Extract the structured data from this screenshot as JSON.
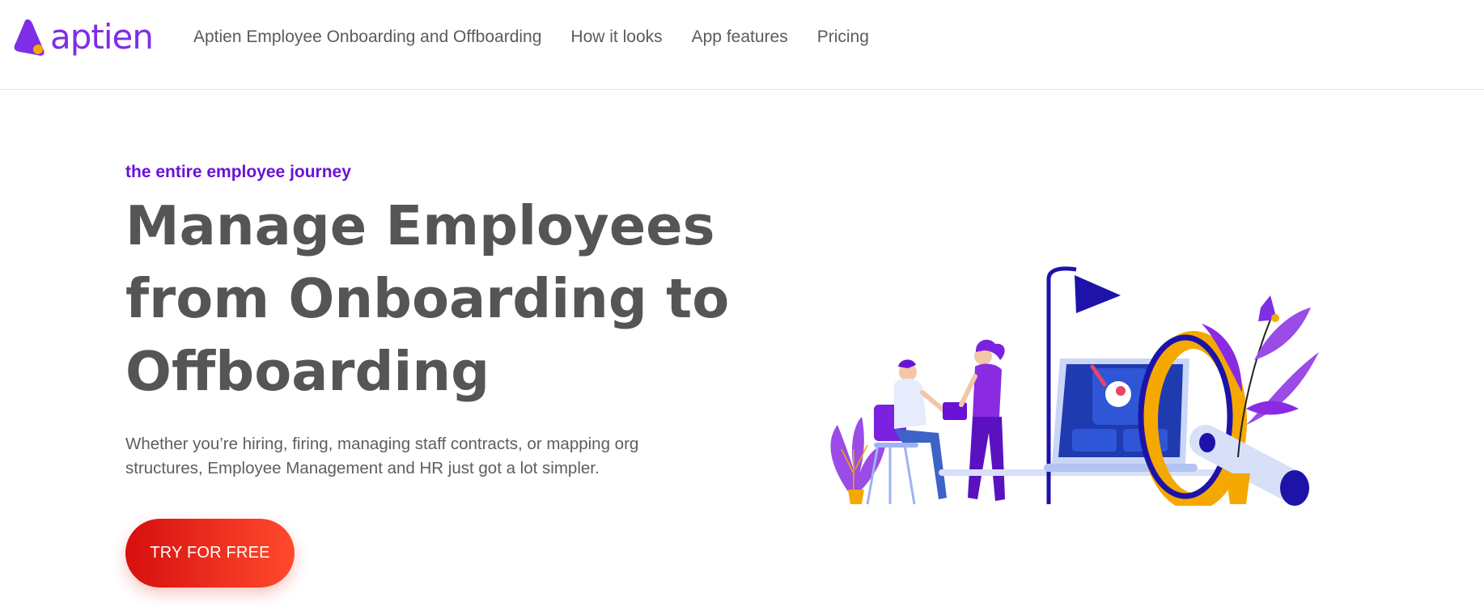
{
  "brand": {
    "name": "aptien",
    "accent_color": "#7d2ee6",
    "logo_dot_color": "#f5a800"
  },
  "nav": {
    "items": [
      {
        "label": "Aptien Employee Onboarding and Offboarding"
      },
      {
        "label": "How it looks"
      },
      {
        "label": "App features"
      },
      {
        "label": "Pricing"
      }
    ]
  },
  "hero": {
    "eyebrow": "the entire employee journey",
    "headline_lines": [
      "Manage Employees",
      "from Onboarding to",
      "Offboarding"
    ],
    "subtitle": "Whether you’re hiring, firing, managing staff contracts, or mapping org structures, Employee Management and HR just got a lot simpler.",
    "cta_label": "TRY FOR FREE",
    "cta_gradient": [
      "#d70f0f",
      "#ff4a2c"
    ]
  },
  "illustration": {
    "icon": "people-working-with-laptop-illustration"
  }
}
